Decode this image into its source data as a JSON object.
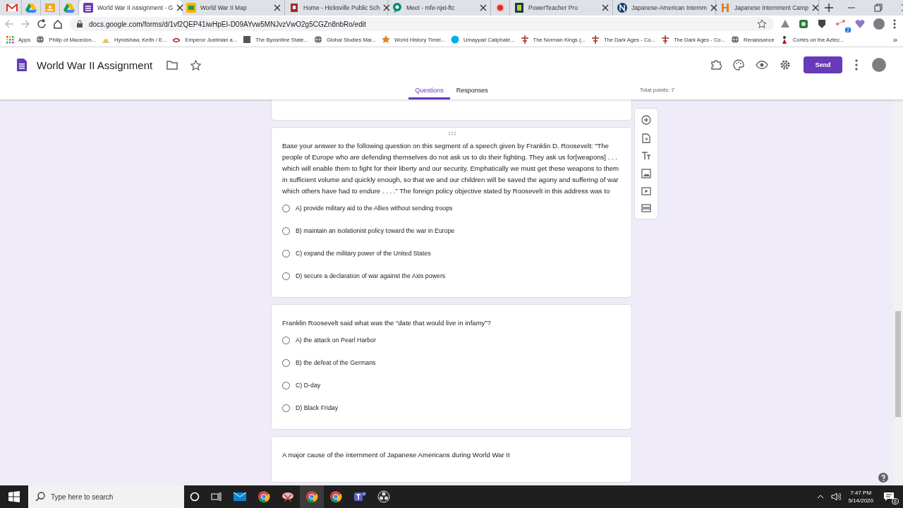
{
  "browser": {
    "tabs": [
      {
        "selected": false
      },
      {
        "selected": false
      },
      {
        "selected": false
      },
      {
        "selected": false
      },
      {
        "title": "World War II Assignment - G",
        "selected": true
      },
      {
        "title": "World War II Map",
        "selected": false
      },
      {
        "title": "Home - Hicksville Public Sch",
        "selected": false
      },
      {
        "title": "Meet - mfe-njxt-ftc",
        "selected": false
      },
      {
        "selected": false
      },
      {
        "title": "PowerTeacher Pro",
        "selected": false
      },
      {
        "title": "Japanese-American Internm",
        "selected": false
      },
      {
        "title": "Japanese Internment Camp",
        "selected": false
      }
    ],
    "url": "docs.google.com/forms/d/1vf2QEP41iwHpEI-D09AYvw5MNJvzVwO2g5CGZn8nbRo/edit",
    "extension_badge": "2",
    "bookmarks": [
      {
        "label": "Apps"
      },
      {
        "label": "Philip of Macedon..."
      },
      {
        "label": "Hyndshaw, Keith / E..."
      },
      {
        "label": "Emperor Justinian a..."
      },
      {
        "label": "The Byzantine State..."
      },
      {
        "label": "Global Studies Mai..."
      },
      {
        "label": "World History Timel..."
      },
      {
        "label": "Umayyad Caliphate..."
      },
      {
        "label": "The Norman Kings (..."
      },
      {
        "label": "The Dark Ages - Co..."
      },
      {
        "label": "The Dark Ages - Co..."
      },
      {
        "label": "Renaissance"
      },
      {
        "label": "Cortés on the Aztec..."
      }
    ],
    "more_bookmarks": "»"
  },
  "form": {
    "title": "World War II Assignment",
    "send_label": "Send",
    "tabs": [
      {
        "label": "Questions",
        "selected": true
      },
      {
        "label": "Responses",
        "selected": false
      }
    ],
    "total_points": "Total points: 7",
    "questions": [
      {
        "text": "Base your answer to the following question on this segment of a speech given by Franklin D. Roosevelt:  “The people of Europe who are defending themselves do not ask us to do their fighting. They ask us for[weapons] . . . which will enable them to fight for their liberty and our security. Emphatically we must get these weapons to them in sufficient volume and quickly enough, so that we and our children will be saved the agony and suffering of war which others have had to endure . . . .”  The foreign policy objective stated by Roosevelt in this address was to",
        "drag_handle": true,
        "options": [
          {
            "label": "A) provide military aid to the Allies without sending troops",
            "selected": false
          },
          {
            "label": "B) maintain an isolationist policy toward the war in Europe",
            "selected": false
          },
          {
            "label": "C) expand the military power of the United States",
            "selected": false
          },
          {
            "label": "D) secure a declaration of war against the Axis powers",
            "selected": false
          }
        ]
      },
      {
        "text": "Franklin Roosevelt said what was the “date that would live in infamy”?",
        "drag_handle": false,
        "options": [
          {
            "label": "A) the attack on Pearl Harbor",
            "selected": false
          },
          {
            "label": "B) the defeat of the Germans",
            "selected": false
          },
          {
            "label": "C) D-day",
            "selected": false
          },
          {
            "label": "D) Black Friday",
            "selected": false
          }
        ]
      },
      {
        "text": "A major cause of the internment of Japanese Americans during World War II",
        "drag_handle": false
      }
    ]
  },
  "taskbar": {
    "search_placeholder": "Type here to search",
    "time": "7:47 PM",
    "date": "5/14/2020",
    "notification_count": "6"
  }
}
